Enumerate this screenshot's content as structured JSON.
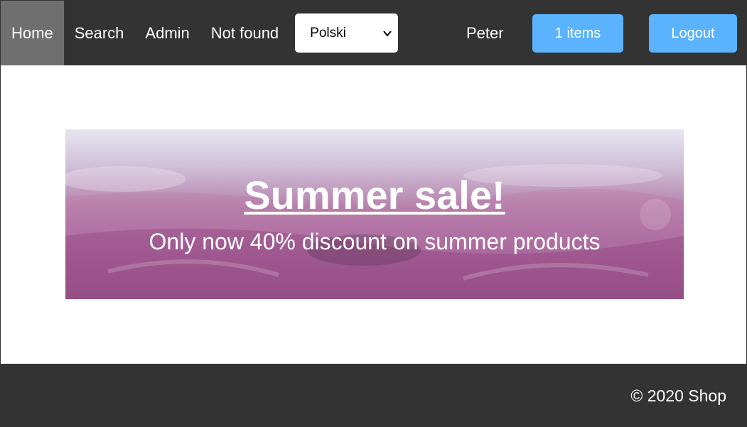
{
  "nav": {
    "links": [
      {
        "label": "Home",
        "active": true
      },
      {
        "label": "Search",
        "active": false
      },
      {
        "label": "Admin",
        "active": false
      },
      {
        "label": "Not found",
        "active": false
      }
    ],
    "language": {
      "selected": "Polski"
    },
    "username": "Peter",
    "cart_label": "1 items",
    "logout_label": "Logout"
  },
  "banner": {
    "title": "Summer sale!",
    "subtitle": "Only now 40% discount on summer products"
  },
  "footer": {
    "copyright": "© 2020 Shop"
  },
  "colors": {
    "navbar": "#333333",
    "active_link": "#6f6f6f",
    "button": "#5cb3fd"
  }
}
